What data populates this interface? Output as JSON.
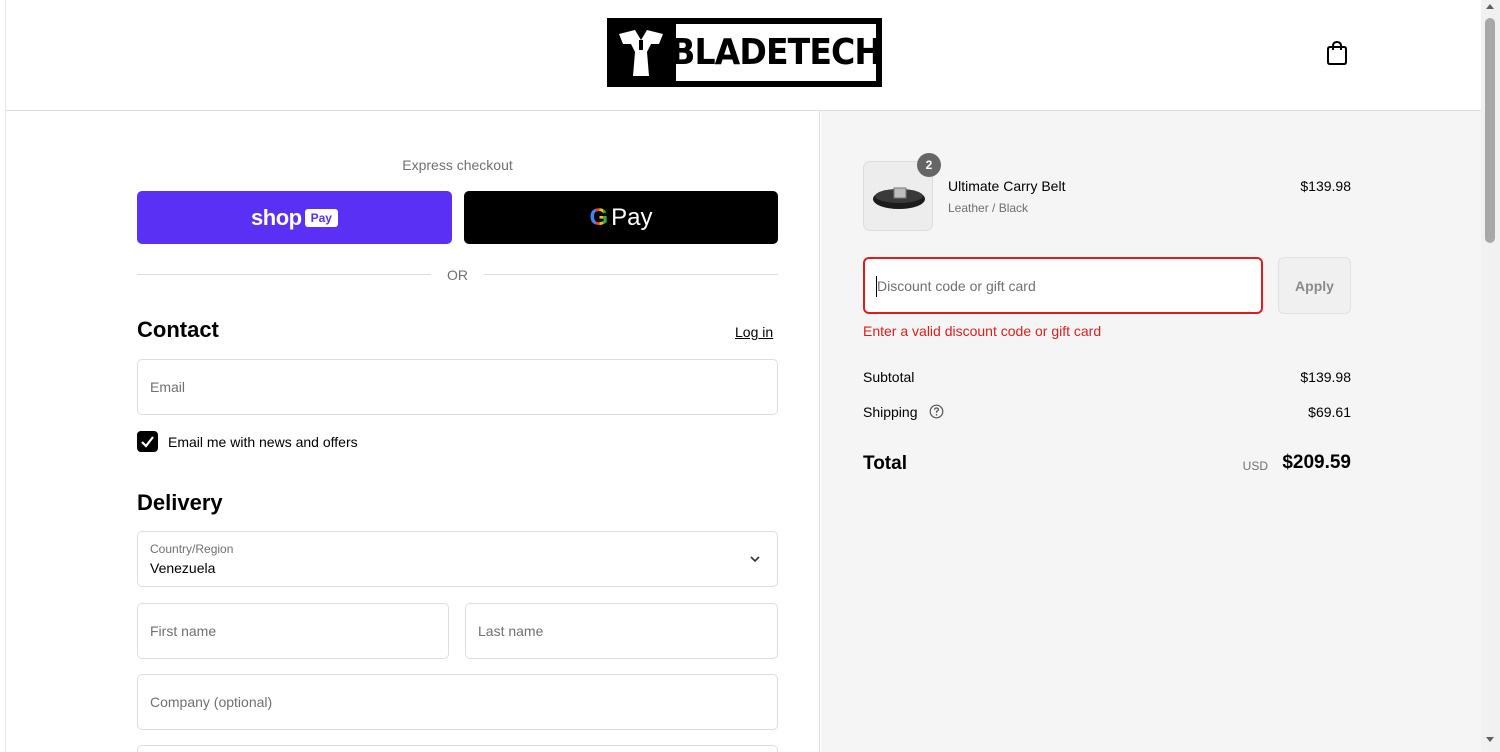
{
  "header": {
    "logo_text": "BLADETECH",
    "cart_icon": "shopping-bag-icon"
  },
  "express": {
    "label": "Express checkout",
    "shop_pay_word": "shop",
    "shop_pay_pill": "Pay",
    "gpay_g": "G",
    "gpay_label": "Pay",
    "or_label": "OR"
  },
  "contact": {
    "title": "Contact",
    "login_label": "Log in",
    "email_placeholder": "Email",
    "newsletter_label": "Email me with news and offers",
    "newsletter_checked": true
  },
  "delivery": {
    "title": "Delivery",
    "country_label": "Country/Region",
    "country_value": "Venezuela",
    "first_name_placeholder": "First name",
    "last_name_placeholder": "Last name",
    "company_placeholder": "Company (optional)"
  },
  "summary": {
    "item": {
      "quantity": "2",
      "name": "Ultimate Carry Belt",
      "variant": "Leather / Black",
      "price": "$139.98"
    },
    "discount_placeholder": "Discount code or gift card",
    "apply_label": "Apply",
    "error_message": "Enter a valid discount code or gift card",
    "subtotal_label": "Subtotal",
    "subtotal_value": "$139.98",
    "shipping_label": "Shipping",
    "shipping_value": "$69.61",
    "total_label": "Total",
    "total_currency": "USD",
    "total_value": "$209.59"
  },
  "colors": {
    "shop_pay": "#5a31f4",
    "error": "#dd1d1d",
    "summary_bg": "#f5f5f5"
  }
}
